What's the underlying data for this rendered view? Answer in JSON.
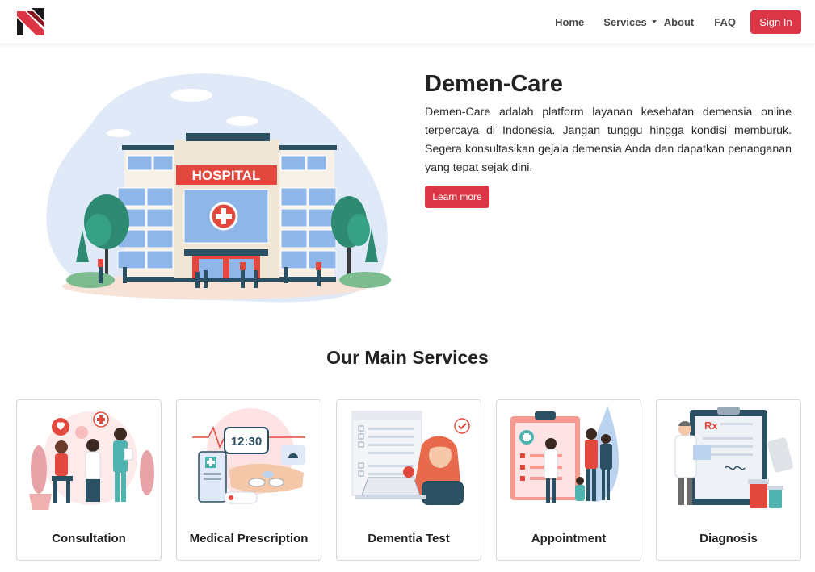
{
  "brand": {
    "logo_icon": "demen-care-logo-icon",
    "accent_color": "#dc3545"
  },
  "nav": {
    "home": "Home",
    "services": "Services",
    "about": "About",
    "faq": "FAQ",
    "signin": "Sign In"
  },
  "hero": {
    "title": "Demen-Care",
    "description": "Demen-Care adalah platform layanan kesehatan demensia online terpercaya di Indonesia. Jangan tunggu hingga kondisi memburuk. Segera konsultasikan gejala demensia Anda dan dapatkan penanganan yang tepat sejak dini.",
    "button": "Learn more",
    "illustration_sign": "HOSPITAL"
  },
  "services": {
    "title": "Our Main Services",
    "cards": [
      {
        "label": "Consultation",
        "icon": "consultation-illustration"
      },
      {
        "label": "Medical Prescription",
        "icon": "medical-prescription-illustration",
        "clock_text": "12:30"
      },
      {
        "label": "Dementia Test",
        "icon": "dementia-test-illustration"
      },
      {
        "label": "Appointment",
        "icon": "appointment-illustration"
      },
      {
        "label": "Diagnosis",
        "icon": "diagnosis-illustration",
        "rx_text": "Rx"
      }
    ]
  }
}
